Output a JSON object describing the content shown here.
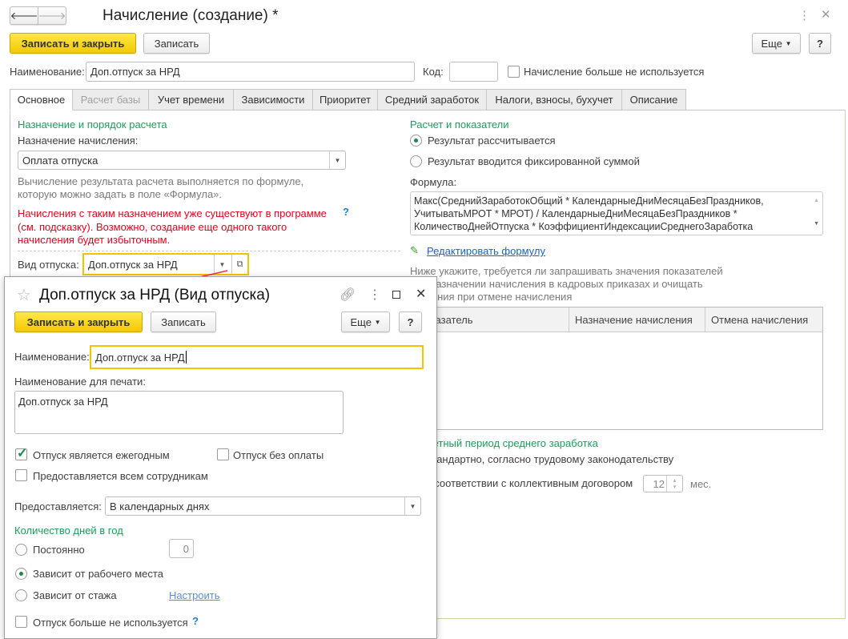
{
  "main": {
    "title": "Начисление (создание) *",
    "save_close": "Записать и закрыть",
    "save": "Записать",
    "more": "Еще",
    "help": "?",
    "name_label": "Наименование:",
    "name_value": "Доп.отпуск за НРД",
    "code_label": "Код:",
    "code_value": "",
    "not_used_label": "Начисление больше не используется",
    "tabs": [
      "Основное",
      "Расчет базы",
      "Учет времени",
      "Зависимости",
      "Приоритет",
      "Средний заработок",
      "Налоги, взносы, бухучет",
      "Описание"
    ],
    "left": {
      "section": "Назначение и порядок расчета",
      "purpose_label": "Назначение начисления:",
      "purpose_value": "Оплата отпуска",
      "hint1": "Вычисление результата расчета выполняется по формуле,",
      "hint2": "которую можно задать в поле «Формула».",
      "warn1": "Начисления с таким назначением уже существуют в программе",
      "warn2": "(см. подсказку). Возможно, создание еще одного такого",
      "warn3": "начисления будет избыточным.",
      "warn_help": "?",
      "vacation_label": "Вид отпуска:",
      "vacation_value": "Доп.отпуск за НРД"
    },
    "right": {
      "section": "Расчет и показатели",
      "radio1": "Результат рассчитывается",
      "radio2": "Результат вводится фиксированной суммой",
      "formula_label": "Формула:",
      "formula_lines": [
        "Макс(СреднийЗаработокОбщий * КалендарныеДниМесяцаБезПраздников,",
        "УчитыватьМРОТ * МРОТ) / КалендарныеДниМесяцаБезПраздников *",
        "КоличествоДнейОтпуска * КоэффициентИндексацииСреднегоЗаработка"
      ],
      "edit_formula": "Редактировать формулу",
      "note1": "Ниже укажите, требуется ли запрашивать значения показателей",
      "note2": "при назначении начисления в кадровых приказах и очищать",
      "note3": "значения при отмене начисления",
      "table_headers": [
        "Показатель",
        "Назначение начисления",
        "Отмена начисления"
      ],
      "period_section": "Расчетный период среднего заработка",
      "period_r1": "Стандартно, согласно трудовому законодательству",
      "period_r2": "В соответствии с коллективным договором",
      "months_value": "12",
      "months_unit": "мес."
    }
  },
  "dialog": {
    "title": "Доп.отпуск за НРД (Вид отпуска)",
    "save_close": "Записать и закрыть",
    "save": "Записать",
    "more": "Еще",
    "help": "?",
    "name_label": "Наименование:",
    "name_value": "Доп.отпуск за НРД",
    "print_label": "Наименование для печати:",
    "print_value": "Доп.отпуск за НРД",
    "annual": "Отпуск является ежегодным",
    "unpaid": "Отпуск без оплаты",
    "all_employees": "Предоставляется всем сотрудникам",
    "provided_label": "Предоставляется:",
    "provided_value": "В календарных днях",
    "days_section": "Количество дней в год",
    "r_const": "Постоянно",
    "const_value": "0",
    "r_workplace": "Зависит от рабочего места",
    "r_seniority": "Зависит от стажа",
    "configure": "Настроить",
    "not_used": "Отпуск больше не используется",
    "not_used_help": "?"
  }
}
